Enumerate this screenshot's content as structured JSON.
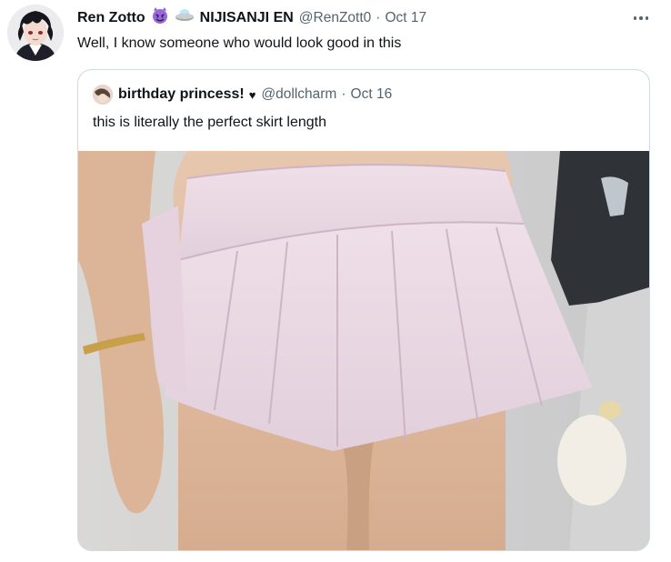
{
  "tweet": {
    "author_name": "Ren Zotto",
    "org_name": "NIJISANJI EN",
    "handle": "@RenZott0",
    "separator": "·",
    "date": "Oct 17",
    "text": "Well, I know someone who would look good in this",
    "emojis": [
      "smiling-imp-emoji",
      "ufo-emoji"
    ],
    "icons": {
      "more": "more-horizontal-icon",
      "avatar": "anime-avatar-icon"
    }
  },
  "quote": {
    "author_name": "birthday princess!",
    "heart_icon": "black-heart-icon",
    "handle": "@dollcharm",
    "separator": "·",
    "date": "Oct 16",
    "text": "this is literally the perfect skirt length",
    "media": "photo-pink-pleated-skirt"
  },
  "colors": {
    "text_primary": "#0f1419",
    "text_secondary": "#536471",
    "border": "#cfd9de",
    "skirt": "#ead7e4"
  }
}
